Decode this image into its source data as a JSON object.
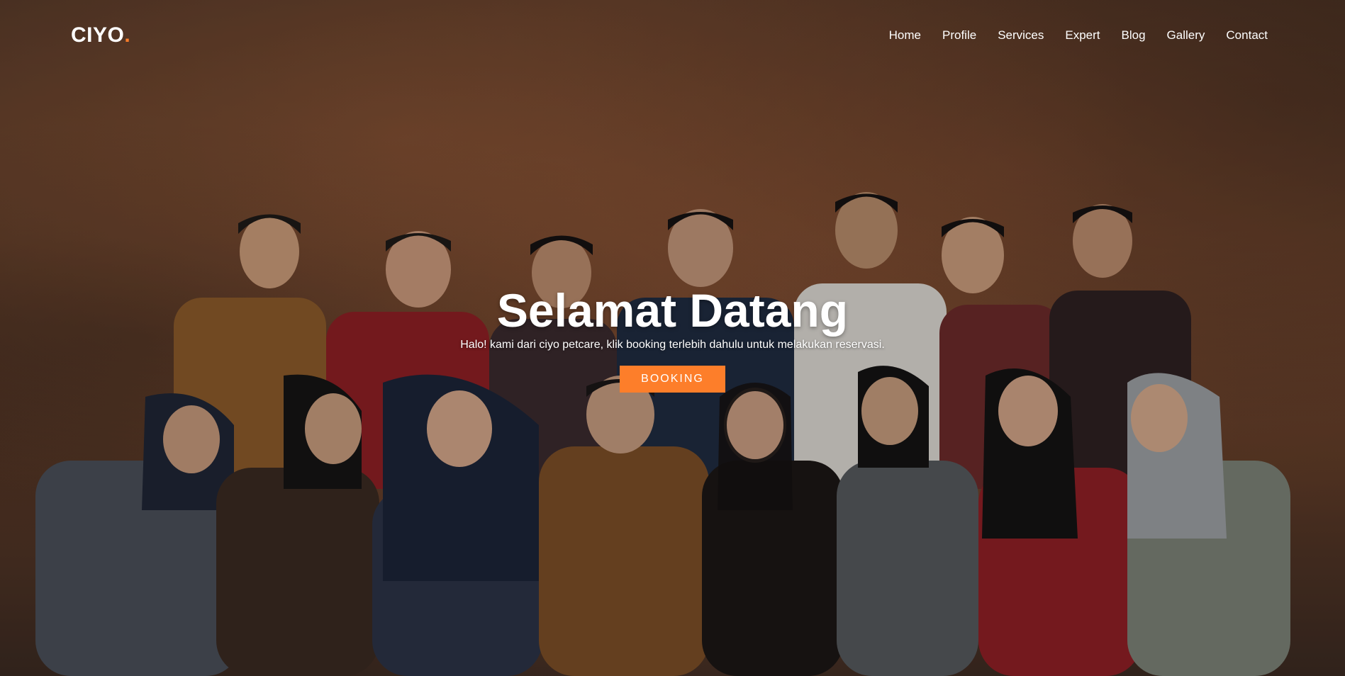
{
  "brand": {
    "name": "CIYO",
    "dot": ".",
    "accent_color": "#fd7e2a"
  },
  "nav": {
    "items": [
      {
        "label": "Home"
      },
      {
        "label": "Profile"
      },
      {
        "label": "Services"
      },
      {
        "label": "Expert"
      },
      {
        "label": "Blog"
      },
      {
        "label": "Gallery"
      },
      {
        "label": "Contact"
      }
    ]
  },
  "hero": {
    "title": "Selamat Datang",
    "subtitle": "Halo! kami dari ciyo petcare, klik booking terlebih dahulu untuk melakukan reservasi.",
    "button_label": "BOOKING",
    "background": "group-photo-team-batik"
  }
}
